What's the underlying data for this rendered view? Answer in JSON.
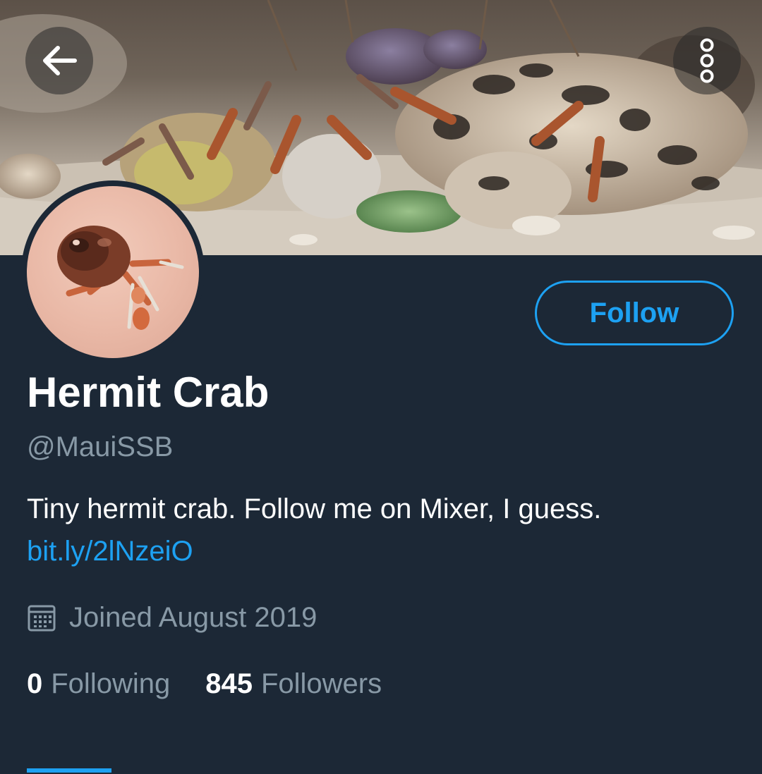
{
  "banner": {
    "image": "hermit-crabs-on-sand-photo"
  },
  "header": {
    "back_icon": "arrow-left-icon",
    "more_icon": "more-vertical-icon"
  },
  "profile": {
    "avatar": "hermit-crab-avatar-photo",
    "follow_label": "Follow",
    "display_name": "Hermit Crab",
    "handle": "@MauiSSB",
    "bio": "Tiny hermit crab. Follow me on Mixer, I guess.",
    "bio_link": "bit.ly/2lNzeiO",
    "joined_icon": "calendar-icon",
    "joined": "Joined August 2019",
    "following_count": "0",
    "following_label": "Following",
    "followers_count": "845",
    "followers_label": "Followers"
  },
  "colors": {
    "background": "#1c2836",
    "accent": "#1da1f2",
    "secondary_text": "#8899a6",
    "primary_text": "#ffffff"
  }
}
